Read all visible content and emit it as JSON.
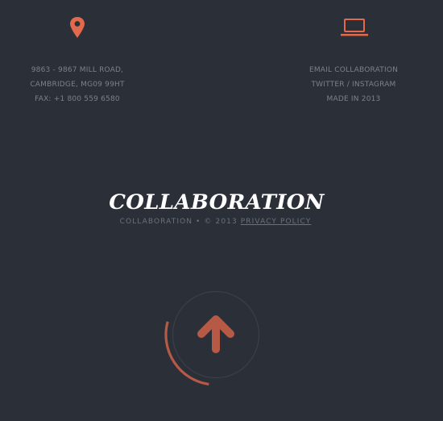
{
  "icons": {
    "location": "map-pin-icon",
    "laptop": "laptop-icon",
    "scroll_top": "arrow-up-icon"
  },
  "colors": {
    "background": "#2b2f38",
    "accent": "#e2694b",
    "arrow": "#b65a46",
    "text": "#7d8089",
    "brand": "#ffffff"
  },
  "contact_left": {
    "line1": "9863 - 9867 MILL ROAD,",
    "line2": "CAMBRIDGE, MG09 99HT",
    "line3": "FAX: +1 800 559 6580"
  },
  "contact_right": {
    "line1": "EMAIL COLLABORATION",
    "line2": "TWITTER / INSTAGRAM",
    "line3": "MADE IN 2013"
  },
  "footer": {
    "brand": "COLLABORATION",
    "copyright": "COLLABORATION • © 2013",
    "privacy_link": "PRIVACY POLICY"
  },
  "scroll_progress": 0.27
}
